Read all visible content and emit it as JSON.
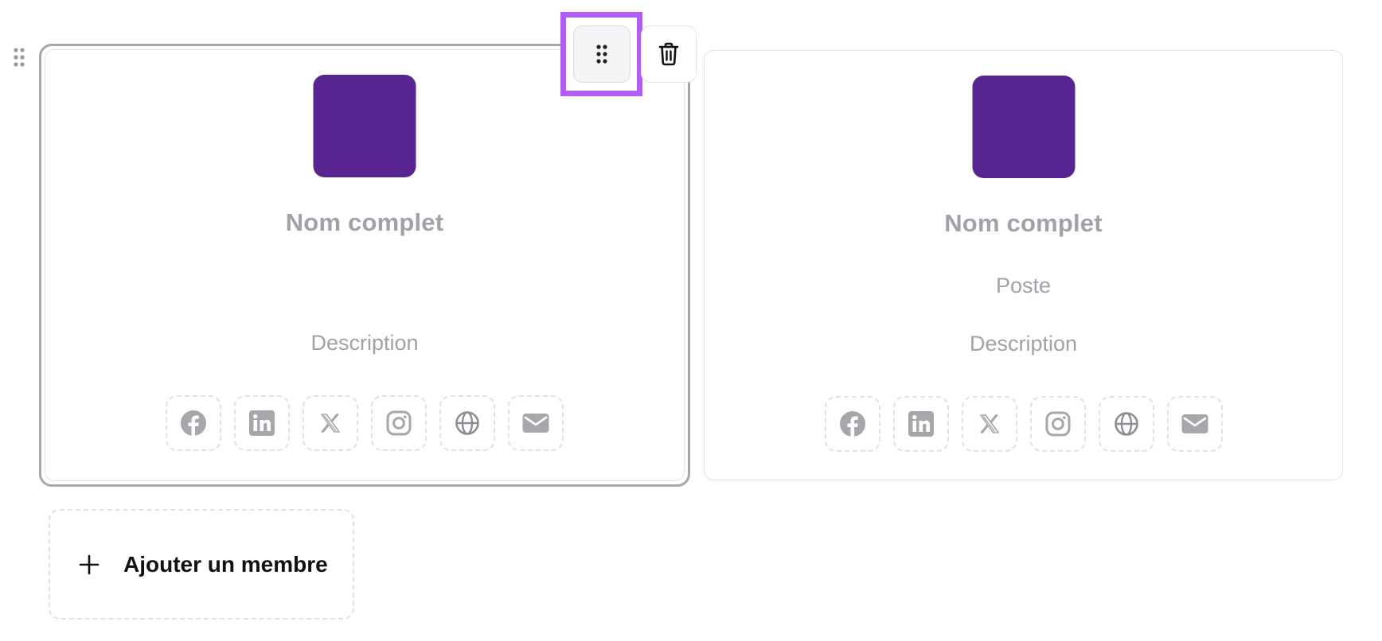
{
  "cards": [
    {
      "name_placeholder": "Nom complet",
      "poste_placeholder": "",
      "description_placeholder": "Description",
      "avatar_color": "#572490",
      "selected": true,
      "socials": [
        "facebook-icon",
        "linkedin-icon",
        "x-icon",
        "instagram-icon",
        "globe-icon",
        "mail-icon"
      ]
    },
    {
      "name_placeholder": "Nom complet",
      "poste_placeholder": "Poste",
      "description_placeholder": "Description",
      "avatar_color": "#572490",
      "selected": false,
      "socials": [
        "facebook-icon",
        "linkedin-icon",
        "x-icon",
        "instagram-icon",
        "globe-icon",
        "mail-icon"
      ]
    }
  ],
  "toolbar": {
    "drag_icon": "drag-handle-icon",
    "delete_icon": "trash-icon",
    "highlight_color": "#b45cf9"
  },
  "add_member": {
    "label": "Ajouter un membre",
    "icon": "plus-icon"
  },
  "colors": {
    "placeholder_text": "#a3a1a7",
    "icon_gray": "#a8a6ab",
    "selected_border": "#a8a6ab"
  }
}
